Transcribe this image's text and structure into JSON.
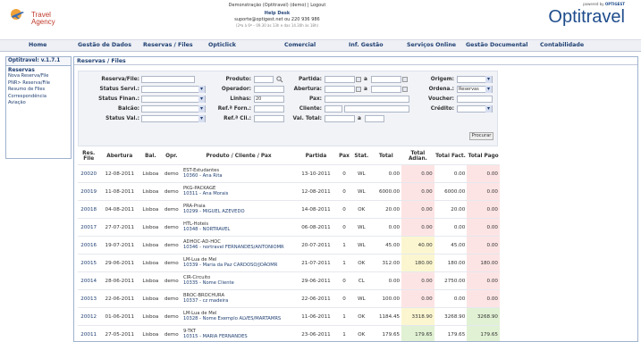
{
  "header": {
    "logo_line1": "Travel",
    "logo_line2": "Agency",
    "session_line": "Demonstração (Optitravel) (demo) | Logout",
    "help_title": "Help Desk",
    "help_contact": "suporte@optigest.net ou 220 936 986",
    "help_hours": "(2ªa à 6ª – 09.30 às 13h e das 14.30h às 18h)",
    "brand": "Optitravel",
    "brand_tag_prefix": "powered by",
    "brand_tag_name": "OPTIGEST"
  },
  "nav": [
    "Home",
    "Gestão de Dados",
    "Reservas / Files",
    "Opticlick",
    "Comercial",
    "Inf. Gestão",
    "Serviços Online",
    "Gestão Documental",
    "Contabilidade"
  ],
  "sidebar": {
    "version": "Optitravel: v.1.7.1",
    "section": "Reservas",
    "links": [
      "Nova Reserva/File",
      "PNR> Reserva/File",
      "Resumo de Files",
      "Correspondência",
      "Aviação"
    ]
  },
  "panel_title": "Reservas / Files",
  "filters": {
    "reserva_file": "Reserva/File:",
    "produto": "Produto:",
    "partida": "Partida:",
    "partida_sep": "a",
    "origem": "Origem:",
    "status_servi": "Status Servi.:",
    "operador": "Operador:",
    "abertura": "Abertura:",
    "abertura_sep": "a",
    "ordena": "Ordena.:",
    "ordena_value": "Reservas",
    "status_finan": "Status Finan.:",
    "linhas": "Linhas:",
    "linhas_value": "20",
    "pax": "Pax:",
    "voucher": "Voucher:",
    "balcao": "Balcão:",
    "ref_forn": "Ref.ª Forn.:",
    "cliente": "Cliente:",
    "credito": "Crédito:",
    "status_val": "Status Val.:",
    "ref_cli": "Ref.ª Cli.:",
    "val_total": "Val. Total:",
    "val_sep": "a",
    "search_button": "Procurar"
  },
  "table": {
    "headers": [
      "Res. File",
      "Abertura",
      "Bal.",
      "Opr.",
      "Produto / Cliente / Pax",
      "Partida",
      "Pax",
      "Stat.",
      "Total",
      "Total Adian.",
      "Total Fact.",
      "Total Pago"
    ],
    "rows": [
      {
        "file": "20020",
        "abertura": "12-08-2011",
        "bal": "Lisboa",
        "opr": "demo",
        "prod": "EST-Estudantes",
        "cli": "10360 - Ana Rita",
        "partida": "13-10-2011",
        "pax": "0",
        "stat": "WL",
        "total": "0.00",
        "adian": "0.00",
        "fact": "0.00",
        "pago": "0.00",
        "adian_c": "pink",
        "pago_c": "pink"
      },
      {
        "file": "20019",
        "abertura": "11-08-2011",
        "bal": "Lisboa",
        "opr": "demo",
        "prod": "PKG-PACKAGE",
        "cli": "10311 - Ana Morais",
        "partida": "12-08-2011",
        "pax": "0",
        "stat": "WL",
        "total": "6000.00",
        "adian": "0.00",
        "fact": "6000.00",
        "pago": "0.00",
        "adian_c": "pink",
        "pago_c": "pink"
      },
      {
        "file": "20018",
        "abertura": "04-08-2011",
        "bal": "Lisboa",
        "opr": "demo",
        "prod": "PRA-Praia",
        "cli": "10299 - MIGUEL AZEVEDO",
        "partida": "14-08-2011",
        "pax": "0",
        "stat": "OK",
        "total": "20.00",
        "adian": "0.00",
        "fact": "20.00",
        "pago": "0.00",
        "adian_c": "pink",
        "pago_c": "pink"
      },
      {
        "file": "20017",
        "abertura": "27-07-2011",
        "bal": "Lisboa",
        "opr": "demo",
        "prod": "HTL-Hoteis",
        "cli": "10348 - NORTRAVEL",
        "partida": "06-08-2011",
        "pax": "0",
        "stat": "WL",
        "total": "0.00",
        "adian": "0.00",
        "fact": "0.00",
        "pago": "0.00",
        "adian_c": "pink",
        "pago_c": "pink"
      },
      {
        "file": "20016",
        "abertura": "19-07-2011",
        "bal": "Lisboa",
        "opr": "demo",
        "prod": "ADHOC-AD-HOC",
        "cli": "10346 - nortravel FERNANDES/ANTONIOMR",
        "partida": "20-07-2011",
        "pax": "1",
        "stat": "WL",
        "total": "45.00",
        "adian": "40.00",
        "fact": "45.00",
        "pago": "0.00",
        "adian_c": "yel",
        "pago_c": "pink"
      },
      {
        "file": "20015",
        "abertura": "29-06-2011",
        "bal": "Lisboa",
        "opr": "demo",
        "prod": "LM-Lua de Mel",
        "cli": "10339 - Maria da Paz CARDOSO/JOÃOMR",
        "partida": "21-07-2011",
        "pax": "1",
        "stat": "OK",
        "total": "312.00",
        "adian": "180.00",
        "fact": "180.00",
        "pago": "180.00",
        "adian_c": "yel",
        "pago_c": "pink"
      },
      {
        "file": "20014",
        "abertura": "28-06-2011",
        "bal": "Lisboa",
        "opr": "demo",
        "prod": "CIR-Circuito",
        "cli": "10335 - Nome Cliente",
        "partida": "29-06-2011",
        "pax": "0",
        "stat": "CL",
        "total": "0.00",
        "adian": "0.00",
        "fact": "2750.00",
        "pago": "0.00",
        "adian_c": "pink",
        "pago_c": "pink"
      },
      {
        "file": "20013",
        "abertura": "22-06-2011",
        "bal": "Lisboa",
        "opr": "demo",
        "prod": "BROC-BROCHURA",
        "cli": "10337 - cz madeira",
        "partida": "22-06-2011",
        "pax": "0",
        "stat": "WL",
        "total": "100.00",
        "adian": "0.00",
        "fact": "0.00",
        "pago": "0.00",
        "adian_c": "pink",
        "pago_c": "pink"
      },
      {
        "file": "20012",
        "abertura": "01-06-2011",
        "bal": "Lisboa",
        "opr": "demo",
        "prod": "LM-Lua de Mel",
        "cli": "10328 - Nome Exemplo ALVES/MARTAMRS",
        "partida": "11-06-2011",
        "pax": "1",
        "stat": "OK",
        "total": "1184.45",
        "adian": "3318.90",
        "fact": "3268.90",
        "pago": "3268.90",
        "adian_c": "yel",
        "pago_c": "grn"
      },
      {
        "file": "20011",
        "abertura": "27-05-2011",
        "bal": "Lisboa",
        "opr": "demo",
        "prod": "9-TKT",
        "cli": "10315 - MARIA FERNANDES",
        "partida": "23-06-2011",
        "pax": "1",
        "stat": "OK",
        "total": "179.65",
        "adian": "179.65",
        "fact": "179.65",
        "pago": "179.65",
        "adian_c": "grn",
        "pago_c": "grn"
      }
    ]
  },
  "colors": {
    "brand": "#1e4c8c",
    "nav_text": "#1f3f72",
    "pink": "#fde4e4",
    "yellow": "#fbf6d0",
    "green": "#e1f1d3"
  }
}
